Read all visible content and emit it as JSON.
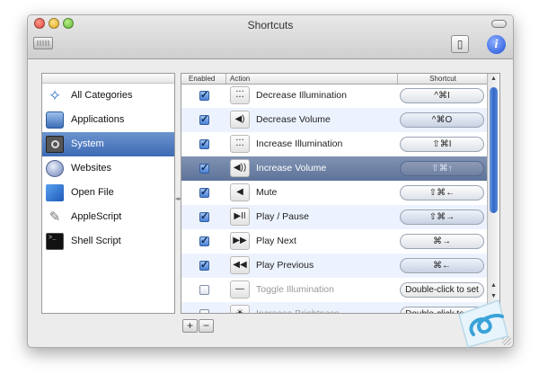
{
  "window": {
    "title": "Shortcuts"
  },
  "toolbar": {
    "info_label": "i",
    "action_glyph": "▯"
  },
  "sidebar": {
    "items": [
      {
        "label": "All Categories",
        "icon": "all-categories-icon",
        "glyph": "✧"
      },
      {
        "label": "Applications",
        "icon": "applications-icon",
        "glyph": ""
      },
      {
        "label": "System",
        "icon": "system-icon",
        "glyph": "",
        "selected": true
      },
      {
        "label": "Websites",
        "icon": "websites-icon",
        "glyph": ""
      },
      {
        "label": "Open File",
        "icon": "open-file-icon",
        "glyph": ""
      },
      {
        "label": "AppleScript",
        "icon": "applescript-icon",
        "glyph": "✎"
      },
      {
        "label": "Shell Script",
        "icon": "shell-script-icon",
        "glyph": ""
      }
    ]
  },
  "table": {
    "columns": {
      "enabled": "Enabled",
      "action": "Action",
      "shortcut": "Shortcut"
    },
    "rows": [
      {
        "enabled": true,
        "action": "Decrease Illumination",
        "icon_glyph": "⁚⁚⁚",
        "shortcut": "^⌘I"
      },
      {
        "enabled": true,
        "action": "Decrease Volume",
        "icon_glyph": "◀)",
        "shortcut": "^⌘O"
      },
      {
        "enabled": true,
        "action": "Increase Illumination",
        "icon_glyph": "⁚⁚⁚",
        "shortcut": "⇧⌘I"
      },
      {
        "enabled": true,
        "action": "Increase Volume",
        "icon_glyph": "◀))",
        "shortcut": "⇧⌘↑",
        "selected": true
      },
      {
        "enabled": true,
        "action": "Mute",
        "icon_glyph": "◀",
        "shortcut": "⇧⌘←"
      },
      {
        "enabled": true,
        "action": "Play / Pause",
        "icon_glyph": "▶II",
        "shortcut": "⇧⌘→"
      },
      {
        "enabled": true,
        "action": "Play Next",
        "icon_glyph": "▶▶",
        "shortcut": "⌘→"
      },
      {
        "enabled": true,
        "action": "Play Previous",
        "icon_glyph": "◀◀",
        "shortcut": "⌘←"
      },
      {
        "enabled": false,
        "action": "Toggle Illumination",
        "icon_glyph": "—",
        "shortcut": "Double-click to set"
      },
      {
        "enabled": false,
        "action": "Increase Brightness",
        "icon_glyph": "☀",
        "shortcut": "Double-click to set"
      }
    ]
  },
  "buttons": {
    "add": "+",
    "remove": "−"
  },
  "colors": {
    "selection": "#3d6ab4",
    "row_selected": "#5e7399",
    "accent": "#1d4fd8"
  }
}
